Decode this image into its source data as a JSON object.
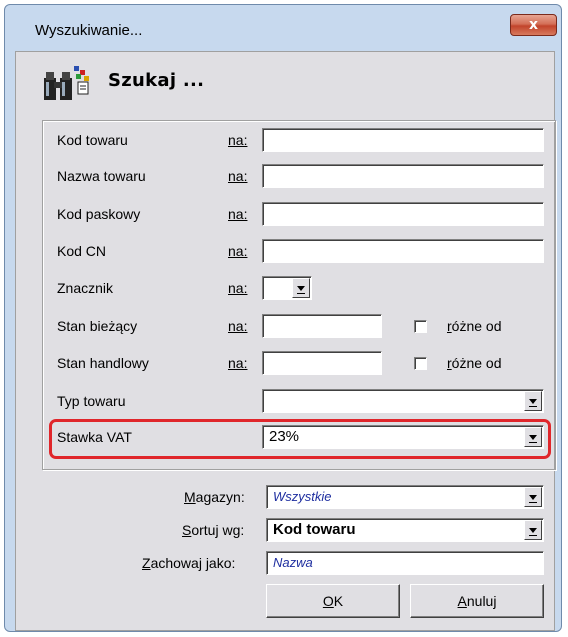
{
  "window": {
    "title": "Wyszukiwanie...",
    "close_glyph": "x"
  },
  "header": {
    "title": "Szukaj ...",
    "icon": "binoculars-icon"
  },
  "fields": {
    "kod_towaru": {
      "label": "Kod towaru",
      "na": "na:",
      "value": ""
    },
    "nazwa_towaru": {
      "label": "Nazwa towaru",
      "na": "na:",
      "value": ""
    },
    "kod_paskowy": {
      "label": "Kod paskowy",
      "na": "na:",
      "value": ""
    },
    "kod_cn": {
      "label": "Kod CN",
      "na": "na:",
      "value": ""
    },
    "znacznik": {
      "label": "Znacznik",
      "na": "na:",
      "value": ""
    },
    "stan_biezacy": {
      "label": "Stan bieżący",
      "na": "na:",
      "value": "",
      "checkbox_label": "różne od",
      "checked": false
    },
    "stan_handlowy": {
      "label": "Stan handlowy",
      "na": "na:",
      "value": "",
      "checkbox_label": "różne od",
      "checked": false
    },
    "typ_towaru": {
      "label": "Typ towaru",
      "value": ""
    },
    "stawka_vat": {
      "label": "Stawka VAT",
      "value": "23%"
    }
  },
  "footer": {
    "magazyn": {
      "label": "Magazyn:",
      "value": "Wszystkie"
    },
    "sortuj": {
      "label": "Sortuj wg:",
      "value": "Kod towaru"
    },
    "zachowaj": {
      "label": "Zachowaj jako:",
      "value": "Nazwa"
    },
    "ok_label": "OK",
    "cancel_label": "Anuluj"
  },
  "colors": {
    "highlight": "#e0262b",
    "dialog_bg": "#e0dfe3",
    "frame": "#c7d9ee"
  }
}
